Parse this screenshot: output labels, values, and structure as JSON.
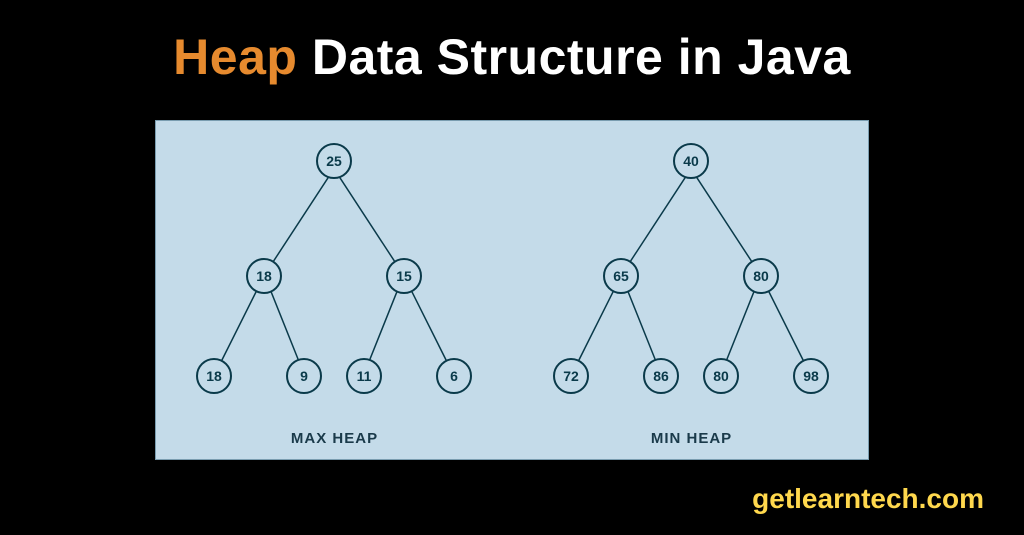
{
  "title": {
    "highlight": "Heap",
    "rest": " Data Structure in Java"
  },
  "colors": {
    "highlight": "#e68a2e",
    "panel_bg": "#c4dbe9",
    "node_border": "#0a3a4a",
    "footer": "#ffd84d"
  },
  "diagram": {
    "max_heap": {
      "label": "MAX HEAP",
      "nodes": {
        "root": "25",
        "l1_left": "18",
        "l1_right": "15",
        "l2_a": "18",
        "l2_b": "9",
        "l2_c": "11",
        "l2_d": "6"
      }
    },
    "min_heap": {
      "label": "MIN HEAP",
      "nodes": {
        "root": "40",
        "l1_left": "65",
        "l1_right": "80",
        "l2_a": "72",
        "l2_b": "86",
        "l2_c": "80",
        "l2_d": "98"
      }
    }
  },
  "footer": "getlearntech.com"
}
